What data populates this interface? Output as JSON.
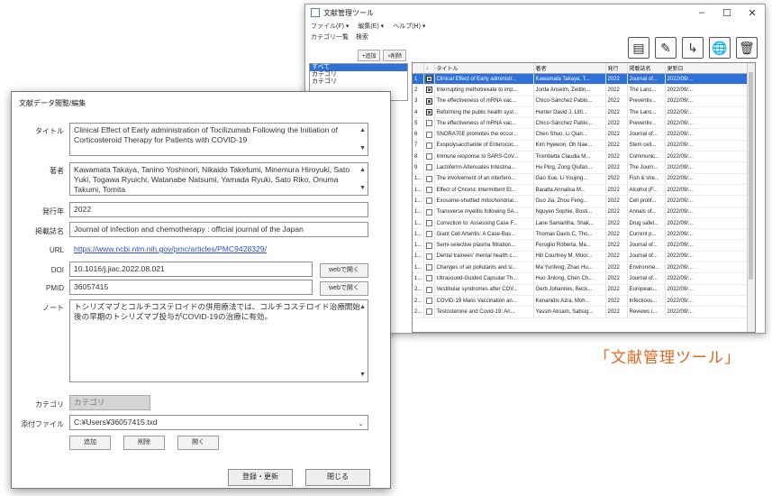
{
  "main_window": {
    "title": "文献管理ツール",
    "menu": [
      "ファイル(F) ▾",
      "編集(E) ▾",
      "ヘルプ(H) ▾"
    ],
    "tabs": [
      "カテゴリ一覧",
      "検索"
    ],
    "category_buttons": [
      "+追加",
      "×削除"
    ],
    "categories": [
      "すべて",
      "カテゴリ",
      "カテゴリ"
    ],
    "columns": [
      "",
      "",
      "タイトル",
      "著者",
      "発行",
      "掲載誌名",
      "更新日"
    ],
    "rows": [
      {
        "n": "1",
        "c": true,
        "title": "Clinical Effect of Early administr...",
        "author": "Kawamata Takaya, T...",
        "year": "2022",
        "journal": "Journal of...",
        "updated": "2022/09/..."
      },
      {
        "n": "2",
        "c": true,
        "title": "Interrupting methotrexate to imp...",
        "author": "Jorda Anselm, Zeitlin...",
        "year": "2022",
        "journal": "The Lanc...",
        "updated": "2022/09/..."
      },
      {
        "n": "3",
        "c": true,
        "title": "The effectiveness of mRNA vac...",
        "author": "Chico-Sánchez Pablo...",
        "year": "2022",
        "journal": "Preventiv...",
        "updated": "2022/09/..."
      },
      {
        "n": "4",
        "c": true,
        "title": "Reforming the public health syst...",
        "author": "Hunter David J, Littl...",
        "year": "2022",
        "journal": "The Lanc...",
        "updated": "2022/09/..."
      },
      {
        "n": "5",
        "c": false,
        "title": "The effectiveness of mRNA vac...",
        "author": "Chico-Sánchez Pablo...",
        "year": "2022",
        "journal": "Preventiv...",
        "updated": "2022/09/..."
      },
      {
        "n": "6",
        "c": false,
        "title": "SNORA70E promotes the occur...",
        "author": "Chen Shuo, Li Qian...",
        "year": "2022",
        "journal": "Journal of...",
        "updated": "2022/09/..."
      },
      {
        "n": "7",
        "c": false,
        "title": "Exopolysaccharide of Enterococ...",
        "author": "Kim Hyewon, Oh Nae...",
        "year": "2022",
        "journal": "Stem cell...",
        "updated": "2022/09/..."
      },
      {
        "n": "8",
        "c": false,
        "title": "Immune response to SARS-CoV...",
        "author": "Trombetta Claudia M...",
        "year": "2022",
        "journal": "Communic...",
        "updated": "2022/09/..."
      },
      {
        "n": "9",
        "c": false,
        "title": "Lactoferrin Attenuates Intestina...",
        "author": "Hu Ping, Zong Qiufan...",
        "year": "2022",
        "journal": "The Journ...",
        "updated": "2022/09/..."
      },
      {
        "n": "1...",
        "c": false,
        "title": "The involvement of an interfero...",
        "author": "Gao Xue, Li Youjing...",
        "year": "2022",
        "journal": "Fish & she...",
        "updated": "2022/09/..."
      },
      {
        "n": "1...",
        "c": false,
        "title": "Effect of Chronic Intermittent Et...",
        "author": "Baratta Annalisa M...",
        "year": "2022",
        "journal": "Alcohol (F...",
        "updated": "2022/09/..."
      },
      {
        "n": "1...",
        "c": false,
        "title": "Exosome-shuttled mitochondrial...",
        "author": "Guo Jia, Zhou Feng...",
        "year": "2022",
        "journal": "Cell prolif...",
        "updated": "2022/09/..."
      },
      {
        "n": "1...",
        "c": false,
        "title": "Transverse myelitis following SA...",
        "author": "Nguyen Sophie, Bosti...",
        "year": "2022",
        "journal": "Annals of...",
        "updated": "2022/09/..."
      },
      {
        "n": "1...",
        "c": false,
        "title": "Correction to: Assessing Case F...",
        "author": "Lane Samantha, Shak...",
        "year": "2022",
        "journal": "Drug safet...",
        "updated": "2022/09/..."
      },
      {
        "n": "1...",
        "c": false,
        "title": "Giant Cell Arteritis: A Case-Bas...",
        "author": "Thomas Davis C, Tho...",
        "year": "2022",
        "journal": "Current p...",
        "updated": "2022/09/..."
      },
      {
        "n": "1...",
        "c": false,
        "title": "Semi-selective plasma filtration...",
        "author": "Feroglio Roberta, Ma...",
        "year": "2022",
        "journal": "Journal of...",
        "updated": "2022/09/..."
      },
      {
        "n": "1...",
        "c": false,
        "title": "Dental trainees' mental health c...",
        "author": "Hill Courtney M, Moor...",
        "year": "2022",
        "journal": "Journal of...",
        "updated": "2022/09/..."
      },
      {
        "n": "1...",
        "c": false,
        "title": "Changes of air pollutants and si...",
        "author": "Ma Yunfeng, Zhao Hu...",
        "year": "2022",
        "journal": "Environme...",
        "updated": "2022/09/..."
      },
      {
        "n": "1...",
        "c": false,
        "title": "Ultrasound-Guided Capsular Th...",
        "author": "Huo Jinlong, Chen Ch...",
        "year": "2022",
        "journal": "Journal of...",
        "updated": "2022/09/..."
      },
      {
        "n": "2...",
        "c": false,
        "title": "Vestibular syndromes after COV...",
        "author": "Gerb Johannes, Beck...",
        "year": "2022",
        "journal": "European...",
        "updated": "2022/09/..."
      },
      {
        "n": "2...",
        "c": false,
        "title": "COVID-19 Mass Vaccination an...",
        "author": "Kenanidis Azra, Moh...",
        "year": "2022",
        "journal": "Infectious...",
        "updated": "2022/09/..."
      },
      {
        "n": "2...",
        "c": false,
        "title": "Testosterone and Covid-19: An...",
        "author": "Yassin Aksam, Sabsig...",
        "year": "2022",
        "journal": "Reviews i...",
        "updated": "2022/09/..."
      }
    ]
  },
  "caption": "「文献管理ツール」",
  "edit_window": {
    "title": "文献データ閲覧/編集",
    "labels": {
      "title": "タイトル",
      "authors": "著者",
      "year": "発行年",
      "journal": "掲載誌名",
      "url": "URL",
      "doi": "DOI",
      "pmid": "PMID",
      "note": "ノート",
      "category": "カテゴリ",
      "attachment": "添付ファイル"
    },
    "values": {
      "title": "Clinical Effect of Early administration of Tocilizumab Following the Initiation of Corticosteroid Therapy for Patients with COVID-19",
      "authors": "Kawamata Takaya, Tanino Yoshinori, Nikaido Takefumi, Minemura Hiroyuki, Sato Yuki, Togawa Ryuichi, Watanabe Natsumi, Yamada Ryuki, Sato Riko, Onuma Takumi, Tomita",
      "year": "2022",
      "journal": "Journal of infection and chemotherapy : official journal of the Japan",
      "url": "https://www.ncbi.nlm.nih.gov/pmc/articles/PMC9428329/",
      "doi": "10.1016/j.jiac.2022.08.021",
      "pmid": "36057415",
      "note": "トシリズマブとコルチコステロイドの併用療法では、コルチコステロイド治療開始後の早期のトシリズマブ投与がCOVID-19の治療に有効。",
      "category": "カテゴリ",
      "attachment": "C:¥Users¥36057415.txd"
    },
    "buttons": {
      "doi_web": "webで開く",
      "pmid_web": "webで開く",
      "add": "追加",
      "remove": "削除",
      "open": "開く",
      "save": "登録・更新",
      "close": "閉じる"
    }
  }
}
